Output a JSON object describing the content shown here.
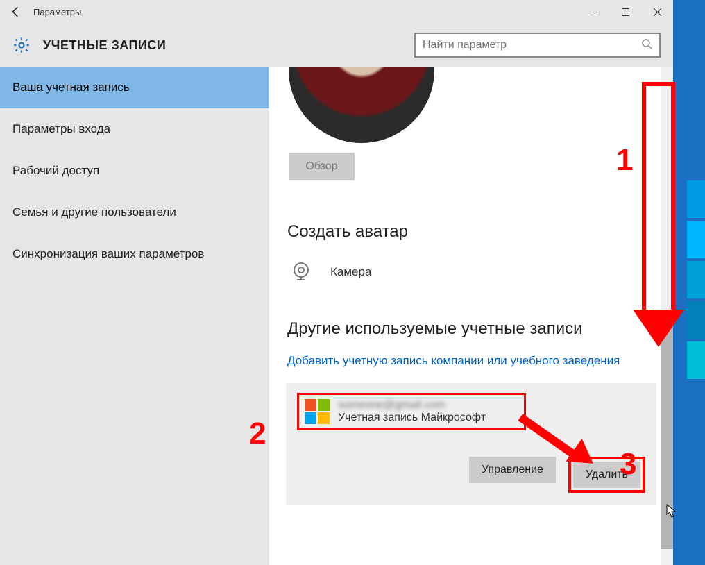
{
  "titlebar": {
    "title": "Параметры"
  },
  "header": {
    "section_title": "УЧЕТНЫЕ ЗАПИСИ",
    "search_placeholder": "Найти параметр"
  },
  "sidebar": {
    "items": [
      {
        "label": "Ваша учетная запись",
        "active": true
      },
      {
        "label": "Параметры входа",
        "active": false
      },
      {
        "label": "Рабочий доступ",
        "active": false
      },
      {
        "label": "Семья и другие пользователи",
        "active": false
      },
      {
        "label": "Синхронизация ваших параметров",
        "active": false
      }
    ]
  },
  "content": {
    "browse_label": "Обзор",
    "create_avatar_heading": "Создать аватар",
    "camera_label": "Камера",
    "other_accounts_heading": "Другие используемые учетные записи",
    "add_link": "Добавить учетную запись компании или учебного заведения",
    "account": {
      "email": "someone@gmail.com",
      "type_label": "Учетная запись Майкрософт",
      "manage_label": "Управление",
      "delete_label": "Удалить"
    }
  },
  "annotations": {
    "n1": "1",
    "n2": "2",
    "n3": "3"
  }
}
